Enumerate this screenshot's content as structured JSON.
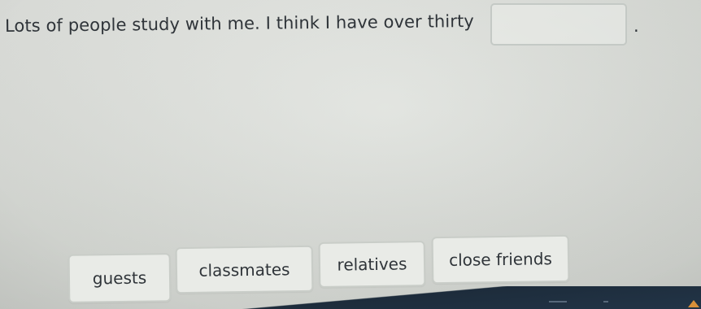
{
  "question": {
    "text": "Lots of people study with me. I think I have over thirty",
    "end_punctuation": "."
  },
  "answer_blank": {
    "value": ""
  },
  "options": [
    {
      "label": "guests"
    },
    {
      "label": "classmates"
    },
    {
      "label": "relatives"
    },
    {
      "label": "close friends"
    }
  ],
  "colors": {
    "background": "#dcdfda",
    "option_background": "#e9ebe7",
    "option_border": "#c9cdc8",
    "text": "#2f3439",
    "taskbar": "#1d2c3b"
  }
}
